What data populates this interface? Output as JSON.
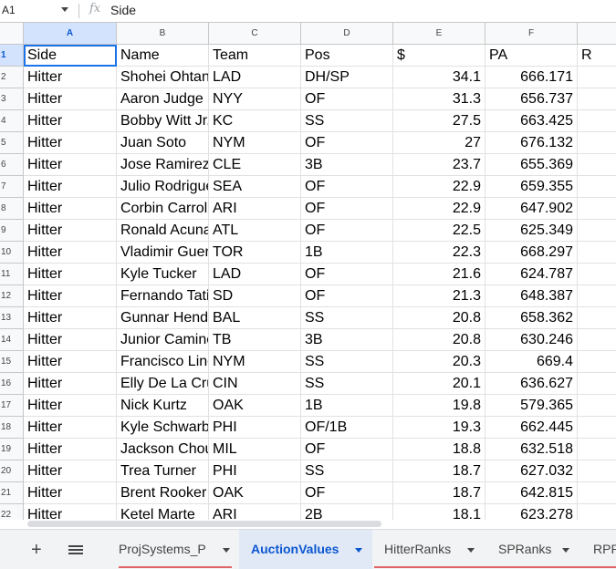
{
  "formula_bar": {
    "name_box": "A1",
    "fx_icon": "fx-icon",
    "value": "Side"
  },
  "columns": [
    "A",
    "B",
    "C",
    "D",
    "E",
    "F"
  ],
  "row_numbers": [
    "1",
    "2",
    "3",
    "4",
    "5",
    "6",
    "7",
    "8",
    "9",
    "10",
    "11",
    "12",
    "13",
    "14",
    "15",
    "16",
    "17",
    "18",
    "19",
    "20",
    "21",
    "22"
  ],
  "header_row": [
    "Side",
    "Name",
    "Team",
    "Pos",
    "$",
    "PA",
    "R"
  ],
  "rows": [
    [
      "Hitter",
      "Shohei Ohtani",
      "LAD",
      "DH/SP",
      "34.1",
      "666.171"
    ],
    [
      "Hitter",
      "Aaron Judge",
      "NYY",
      "OF",
      "31.3",
      "656.737"
    ],
    [
      "Hitter",
      "Bobby Witt Jr.",
      "KC",
      "SS",
      "27.5",
      "663.425"
    ],
    [
      "Hitter",
      "Juan Soto",
      "NYM",
      "OF",
      "27",
      "676.132"
    ],
    [
      "Hitter",
      "Jose Ramirez",
      "CLE",
      "3B",
      "23.7",
      "655.369"
    ],
    [
      "Hitter",
      "Julio Rodriguez",
      "SEA",
      "OF",
      "22.9",
      "659.355"
    ],
    [
      "Hitter",
      "Corbin Carroll",
      "ARI",
      "OF",
      "22.9",
      "647.902"
    ],
    [
      "Hitter",
      "Ronald Acuna",
      "ATL",
      "OF",
      "22.5",
      "625.349"
    ],
    [
      "Hitter",
      "Vladimir Guerrero",
      "TOR",
      "1B",
      "22.3",
      "668.297"
    ],
    [
      "Hitter",
      "Kyle Tucker",
      "LAD",
      "OF",
      "21.6",
      "624.787"
    ],
    [
      "Hitter",
      "Fernando Tatis",
      "SD",
      "OF",
      "21.3",
      "648.387"
    ],
    [
      "Hitter",
      "Gunnar Henderson",
      "BAL",
      "SS",
      "20.8",
      "658.362"
    ],
    [
      "Hitter",
      "Junior Caminero",
      "TB",
      "3B",
      "20.8",
      "630.246"
    ],
    [
      "Hitter",
      "Francisco Lindor",
      "NYM",
      "SS",
      "20.3",
      "669.4"
    ],
    [
      "Hitter",
      "Elly De La Cruz",
      "CIN",
      "SS",
      "20.1",
      "636.627"
    ],
    [
      "Hitter",
      "Nick Kurtz",
      "OAK",
      "1B",
      "19.8",
      "579.365"
    ],
    [
      "Hitter",
      "Kyle Schwarber",
      "PHI",
      "OF/1B",
      "19.3",
      "662.445"
    ],
    [
      "Hitter",
      "Jackson Chourio",
      "MIL",
      "OF",
      "18.8",
      "632.518"
    ],
    [
      "Hitter",
      "Trea Turner",
      "PHI",
      "SS",
      "18.7",
      "627.032"
    ],
    [
      "Hitter",
      "Brent Rooker",
      "OAK",
      "OF",
      "18.7",
      "642.815"
    ],
    [
      "Hitter",
      "Ketel Marte",
      "ARI",
      "2B",
      "18.1",
      "623.278"
    ]
  ],
  "tabs": {
    "add_icon": "+",
    "menu_icon": "all-sheets-icon",
    "sheets": [
      "ProjSystems_P",
      "AuctionValues",
      "HitterRanks",
      "SPRanks",
      "RPRanks"
    ],
    "active": "AuctionValues"
  },
  "colors": {
    "accent": "#1a73e8",
    "selected_header": "#d3e3fd",
    "active_tab": "#e1e9f7"
  }
}
